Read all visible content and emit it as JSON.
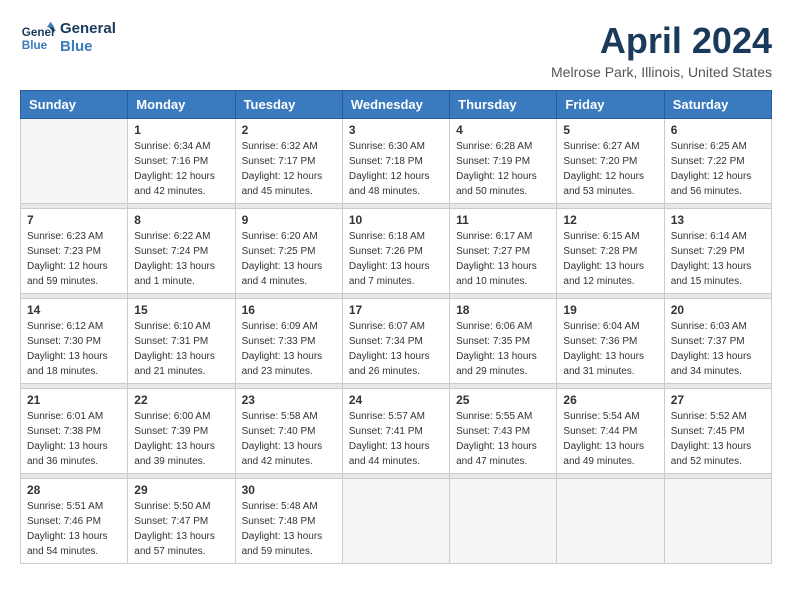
{
  "logo": {
    "line1": "General",
    "line2": "Blue"
  },
  "title": "April 2024",
  "location": "Melrose Park, Illinois, United States",
  "days_of_week": [
    "Sunday",
    "Monday",
    "Tuesday",
    "Wednesday",
    "Thursday",
    "Friday",
    "Saturday"
  ],
  "weeks": [
    [
      {
        "day": "",
        "sunrise": "",
        "sunset": "",
        "daylight": ""
      },
      {
        "day": "1",
        "sunrise": "Sunrise: 6:34 AM",
        "sunset": "Sunset: 7:16 PM",
        "daylight": "Daylight: 12 hours and 42 minutes."
      },
      {
        "day": "2",
        "sunrise": "Sunrise: 6:32 AM",
        "sunset": "Sunset: 7:17 PM",
        "daylight": "Daylight: 12 hours and 45 minutes."
      },
      {
        "day": "3",
        "sunrise": "Sunrise: 6:30 AM",
        "sunset": "Sunset: 7:18 PM",
        "daylight": "Daylight: 12 hours and 48 minutes."
      },
      {
        "day": "4",
        "sunrise": "Sunrise: 6:28 AM",
        "sunset": "Sunset: 7:19 PM",
        "daylight": "Daylight: 12 hours and 50 minutes."
      },
      {
        "day": "5",
        "sunrise": "Sunrise: 6:27 AM",
        "sunset": "Sunset: 7:20 PM",
        "daylight": "Daylight: 12 hours and 53 minutes."
      },
      {
        "day": "6",
        "sunrise": "Sunrise: 6:25 AM",
        "sunset": "Sunset: 7:22 PM",
        "daylight": "Daylight: 12 hours and 56 minutes."
      }
    ],
    [
      {
        "day": "7",
        "sunrise": "Sunrise: 6:23 AM",
        "sunset": "Sunset: 7:23 PM",
        "daylight": "Daylight: 12 hours and 59 minutes."
      },
      {
        "day": "8",
        "sunrise": "Sunrise: 6:22 AM",
        "sunset": "Sunset: 7:24 PM",
        "daylight": "Daylight: 13 hours and 1 minute."
      },
      {
        "day": "9",
        "sunrise": "Sunrise: 6:20 AM",
        "sunset": "Sunset: 7:25 PM",
        "daylight": "Daylight: 13 hours and 4 minutes."
      },
      {
        "day": "10",
        "sunrise": "Sunrise: 6:18 AM",
        "sunset": "Sunset: 7:26 PM",
        "daylight": "Daylight: 13 hours and 7 minutes."
      },
      {
        "day": "11",
        "sunrise": "Sunrise: 6:17 AM",
        "sunset": "Sunset: 7:27 PM",
        "daylight": "Daylight: 13 hours and 10 minutes."
      },
      {
        "day": "12",
        "sunrise": "Sunrise: 6:15 AM",
        "sunset": "Sunset: 7:28 PM",
        "daylight": "Daylight: 13 hours and 12 minutes."
      },
      {
        "day": "13",
        "sunrise": "Sunrise: 6:14 AM",
        "sunset": "Sunset: 7:29 PM",
        "daylight": "Daylight: 13 hours and 15 minutes."
      }
    ],
    [
      {
        "day": "14",
        "sunrise": "Sunrise: 6:12 AM",
        "sunset": "Sunset: 7:30 PM",
        "daylight": "Daylight: 13 hours and 18 minutes."
      },
      {
        "day": "15",
        "sunrise": "Sunrise: 6:10 AM",
        "sunset": "Sunset: 7:31 PM",
        "daylight": "Daylight: 13 hours and 21 minutes."
      },
      {
        "day": "16",
        "sunrise": "Sunrise: 6:09 AM",
        "sunset": "Sunset: 7:33 PM",
        "daylight": "Daylight: 13 hours and 23 minutes."
      },
      {
        "day": "17",
        "sunrise": "Sunrise: 6:07 AM",
        "sunset": "Sunset: 7:34 PM",
        "daylight": "Daylight: 13 hours and 26 minutes."
      },
      {
        "day": "18",
        "sunrise": "Sunrise: 6:06 AM",
        "sunset": "Sunset: 7:35 PM",
        "daylight": "Daylight: 13 hours and 29 minutes."
      },
      {
        "day": "19",
        "sunrise": "Sunrise: 6:04 AM",
        "sunset": "Sunset: 7:36 PM",
        "daylight": "Daylight: 13 hours and 31 minutes."
      },
      {
        "day": "20",
        "sunrise": "Sunrise: 6:03 AM",
        "sunset": "Sunset: 7:37 PM",
        "daylight": "Daylight: 13 hours and 34 minutes."
      }
    ],
    [
      {
        "day": "21",
        "sunrise": "Sunrise: 6:01 AM",
        "sunset": "Sunset: 7:38 PM",
        "daylight": "Daylight: 13 hours and 36 minutes."
      },
      {
        "day": "22",
        "sunrise": "Sunrise: 6:00 AM",
        "sunset": "Sunset: 7:39 PM",
        "daylight": "Daylight: 13 hours and 39 minutes."
      },
      {
        "day": "23",
        "sunrise": "Sunrise: 5:58 AM",
        "sunset": "Sunset: 7:40 PM",
        "daylight": "Daylight: 13 hours and 42 minutes."
      },
      {
        "day": "24",
        "sunrise": "Sunrise: 5:57 AM",
        "sunset": "Sunset: 7:41 PM",
        "daylight": "Daylight: 13 hours and 44 minutes."
      },
      {
        "day": "25",
        "sunrise": "Sunrise: 5:55 AM",
        "sunset": "Sunset: 7:43 PM",
        "daylight": "Daylight: 13 hours and 47 minutes."
      },
      {
        "day": "26",
        "sunrise": "Sunrise: 5:54 AM",
        "sunset": "Sunset: 7:44 PM",
        "daylight": "Daylight: 13 hours and 49 minutes."
      },
      {
        "day": "27",
        "sunrise": "Sunrise: 5:52 AM",
        "sunset": "Sunset: 7:45 PM",
        "daylight": "Daylight: 13 hours and 52 minutes."
      }
    ],
    [
      {
        "day": "28",
        "sunrise": "Sunrise: 5:51 AM",
        "sunset": "Sunset: 7:46 PM",
        "daylight": "Daylight: 13 hours and 54 minutes."
      },
      {
        "day": "29",
        "sunrise": "Sunrise: 5:50 AM",
        "sunset": "Sunset: 7:47 PM",
        "daylight": "Daylight: 13 hours and 57 minutes."
      },
      {
        "day": "30",
        "sunrise": "Sunrise: 5:48 AM",
        "sunset": "Sunset: 7:48 PM",
        "daylight": "Daylight: 13 hours and 59 minutes."
      },
      {
        "day": "",
        "sunrise": "",
        "sunset": "",
        "daylight": ""
      },
      {
        "day": "",
        "sunrise": "",
        "sunset": "",
        "daylight": ""
      },
      {
        "day": "",
        "sunrise": "",
        "sunset": "",
        "daylight": ""
      },
      {
        "day": "",
        "sunrise": "",
        "sunset": "",
        "daylight": ""
      }
    ]
  ]
}
